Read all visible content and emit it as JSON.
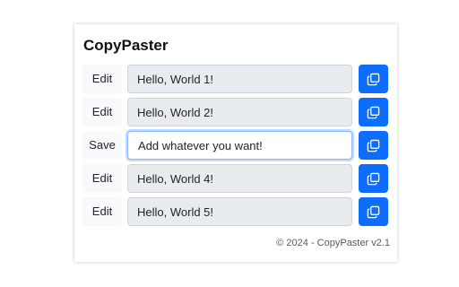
{
  "app": {
    "title": "CopyPaster"
  },
  "rows": [
    {
      "action_label": "Edit",
      "value": "Hello, World 1!",
      "editing": false,
      "copy_icon": "copy-icon"
    },
    {
      "action_label": "Edit",
      "value": "Hello, World 2!",
      "editing": false,
      "copy_icon": "copy-icon"
    },
    {
      "action_label": "Save",
      "value": "Add whatever you want!",
      "editing": true,
      "copy_icon": "copy-icon"
    },
    {
      "action_label": "Edit",
      "value": "Hello, World 4!",
      "editing": false,
      "copy_icon": "copy-icon"
    },
    {
      "action_label": "Edit",
      "value": "Hello, World 5!",
      "editing": false,
      "copy_icon": "copy-icon"
    }
  ],
  "footer": {
    "text": "© 2024 - CopyPaster v2.1"
  },
  "colors": {
    "accent": "#0d6efd",
    "readonly_field_bg": "#e9ecef",
    "focus_border": "#86b7fe",
    "action_button_bg": "#f8f9fa"
  }
}
